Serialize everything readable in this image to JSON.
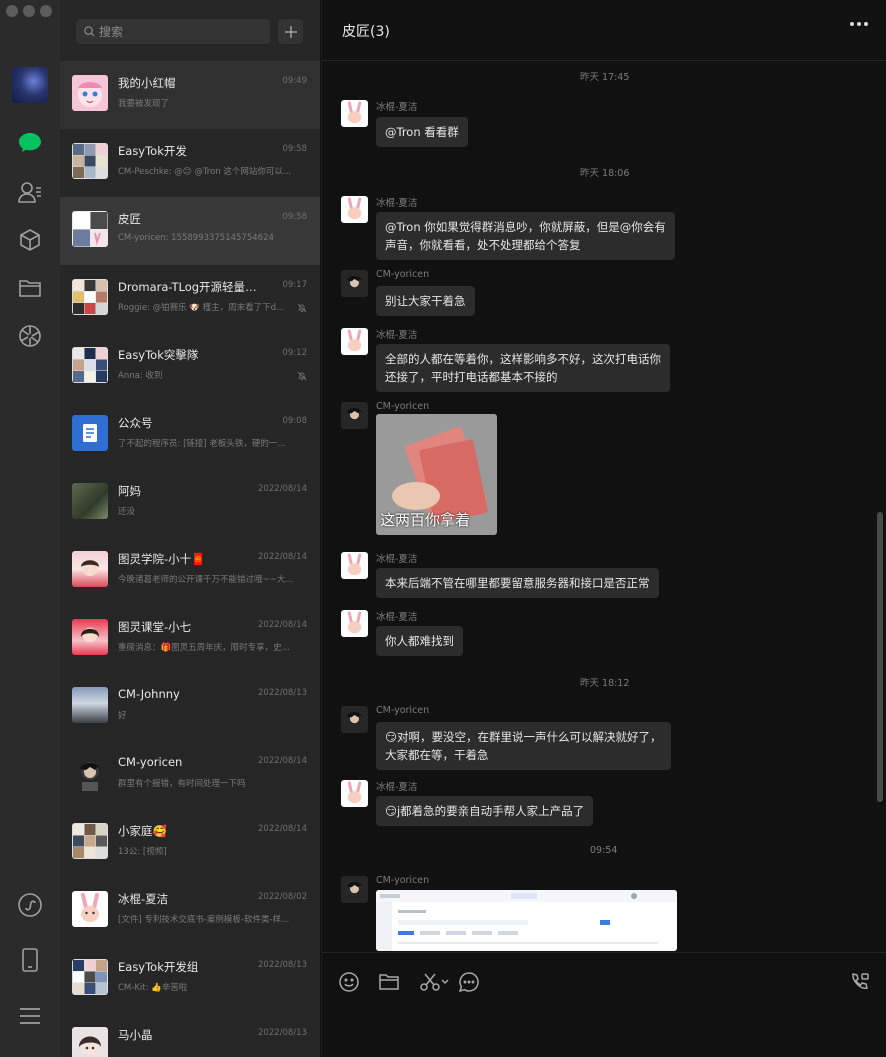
{
  "window": {
    "buttons": [
      "close",
      "minimize",
      "maximize"
    ]
  },
  "rail": {
    "icons": [
      "chat-icon",
      "contacts-icon",
      "favorites-icon",
      "files-icon",
      "moments-icon",
      "mini-program-icon",
      "phone-icon",
      "menu-icon"
    ],
    "active": "chat-icon",
    "accent": "#07c160"
  },
  "search": {
    "placeholder": "搜索"
  },
  "conversations": [
    {
      "name": "我的小红帽",
      "time": "09:49",
      "preview": "我要被发现了",
      "muted": false
    },
    {
      "name": "EasyTok开发",
      "time": "09:58",
      "preview": "CM-Peschke: @😊 @Tron 这个网站你可以...",
      "muted": false
    },
    {
      "name": "皮匠",
      "time": "09:58",
      "preview": "CM-yoricen: 1558993375145754624",
      "muted": false
    },
    {
      "name": "Dromara-TLog开源轻量级日...",
      "time": "09:17",
      "preview": "Roggie: @铂赛乐 🐶 槿主，周末看了下d...",
      "muted": true
    },
    {
      "name": "EasyTok突擊隊",
      "time": "09:12",
      "preview": "Anna: 收到",
      "muted": true
    },
    {
      "name": "公众号",
      "time": "09:08",
      "preview": "了不起的程序员: [链接] 老板头铁，硬的一...",
      "muted": false
    },
    {
      "name": "阿妈",
      "time": "2022/08/14",
      "preview": "还没",
      "muted": false
    },
    {
      "name": "图灵学院-小十🧧",
      "time": "2022/08/14",
      "preview": "今晚诸葛老师的公开课千万不能错过哦~~大...",
      "muted": false
    },
    {
      "name": "图灵课堂-小七",
      "time": "2022/08/14",
      "preview": "重磅消息：🎁图灵五周年庆，限时专享，史...",
      "muted": false
    },
    {
      "name": "CM-Johnny",
      "time": "2022/08/13",
      "preview": "好",
      "muted": false
    },
    {
      "name": "CM-yoricen",
      "time": "2022/08/14",
      "preview": "群里有个报错，有时间处理一下吗",
      "muted": false
    },
    {
      "name": "小家庭🥰",
      "time": "2022/08/14",
      "preview": "13公: [视频]",
      "muted": false
    },
    {
      "name": "冰棍-夏洁",
      "time": "2022/08/02",
      "preview": "[文件] 专利技术交底书-案例模板-软件类-样...",
      "muted": false
    },
    {
      "name": "EasyTok开发组",
      "time": "2022/08/13",
      "preview": "CM-Kit: 👍辛苦啦",
      "muted": false
    },
    {
      "name": "马小晶",
      "time": "2022/08/13",
      "preview": "",
      "muted": false
    }
  ],
  "chat": {
    "title": "皮匠(3)",
    "stamps": [
      "昨天 17:45",
      "昨天 18:06",
      "昨天 18:12",
      "09:54"
    ],
    "messages": [
      {
        "sender": "冰棍-夏洁",
        "text": "@Tron 看看群"
      },
      {
        "sender": "冰棍-夏洁",
        "text": "@Tron 你如果觉得群消息吵，你就屏蔽，但是@你会有",
        "text2": "声音，你就看看，处不处理都给个答复"
      },
      {
        "sender": "CM-yoricen",
        "text": "别让大家干着急"
      },
      {
        "sender": "冰棍-夏洁",
        "text": "全部的人都在等着你，这样影响多不好，这次打电话你",
        "text2": "还接了，平时打电话都基本不接的"
      },
      {
        "sender": "CM-yoricen",
        "image_caption": "这两百你拿着"
      },
      {
        "sender": "冰棍-夏洁",
        "text": "本来后端不管在哪里都要留意服务器和接口是否正常"
      },
      {
        "sender": "冰棍-夏洁",
        "text": "你人都难找到"
      },
      {
        "sender": "CM-yoricen",
        "text": "😏对啊，要没空，在群里说一声什么可以解决就好了，",
        "text2": "大家都在等，干着急"
      },
      {
        "sender": "冰棍-夏洁",
        "text": "😏j都着急的要亲自动手帮人家上产品了"
      },
      {
        "sender": "CM-yoricen",
        "image": "screenshot"
      }
    ]
  },
  "input": {
    "tools": [
      "emoji-icon",
      "folder-icon",
      "scissors-icon",
      "chat-bubble-icon",
      "video-call-icon"
    ]
  }
}
